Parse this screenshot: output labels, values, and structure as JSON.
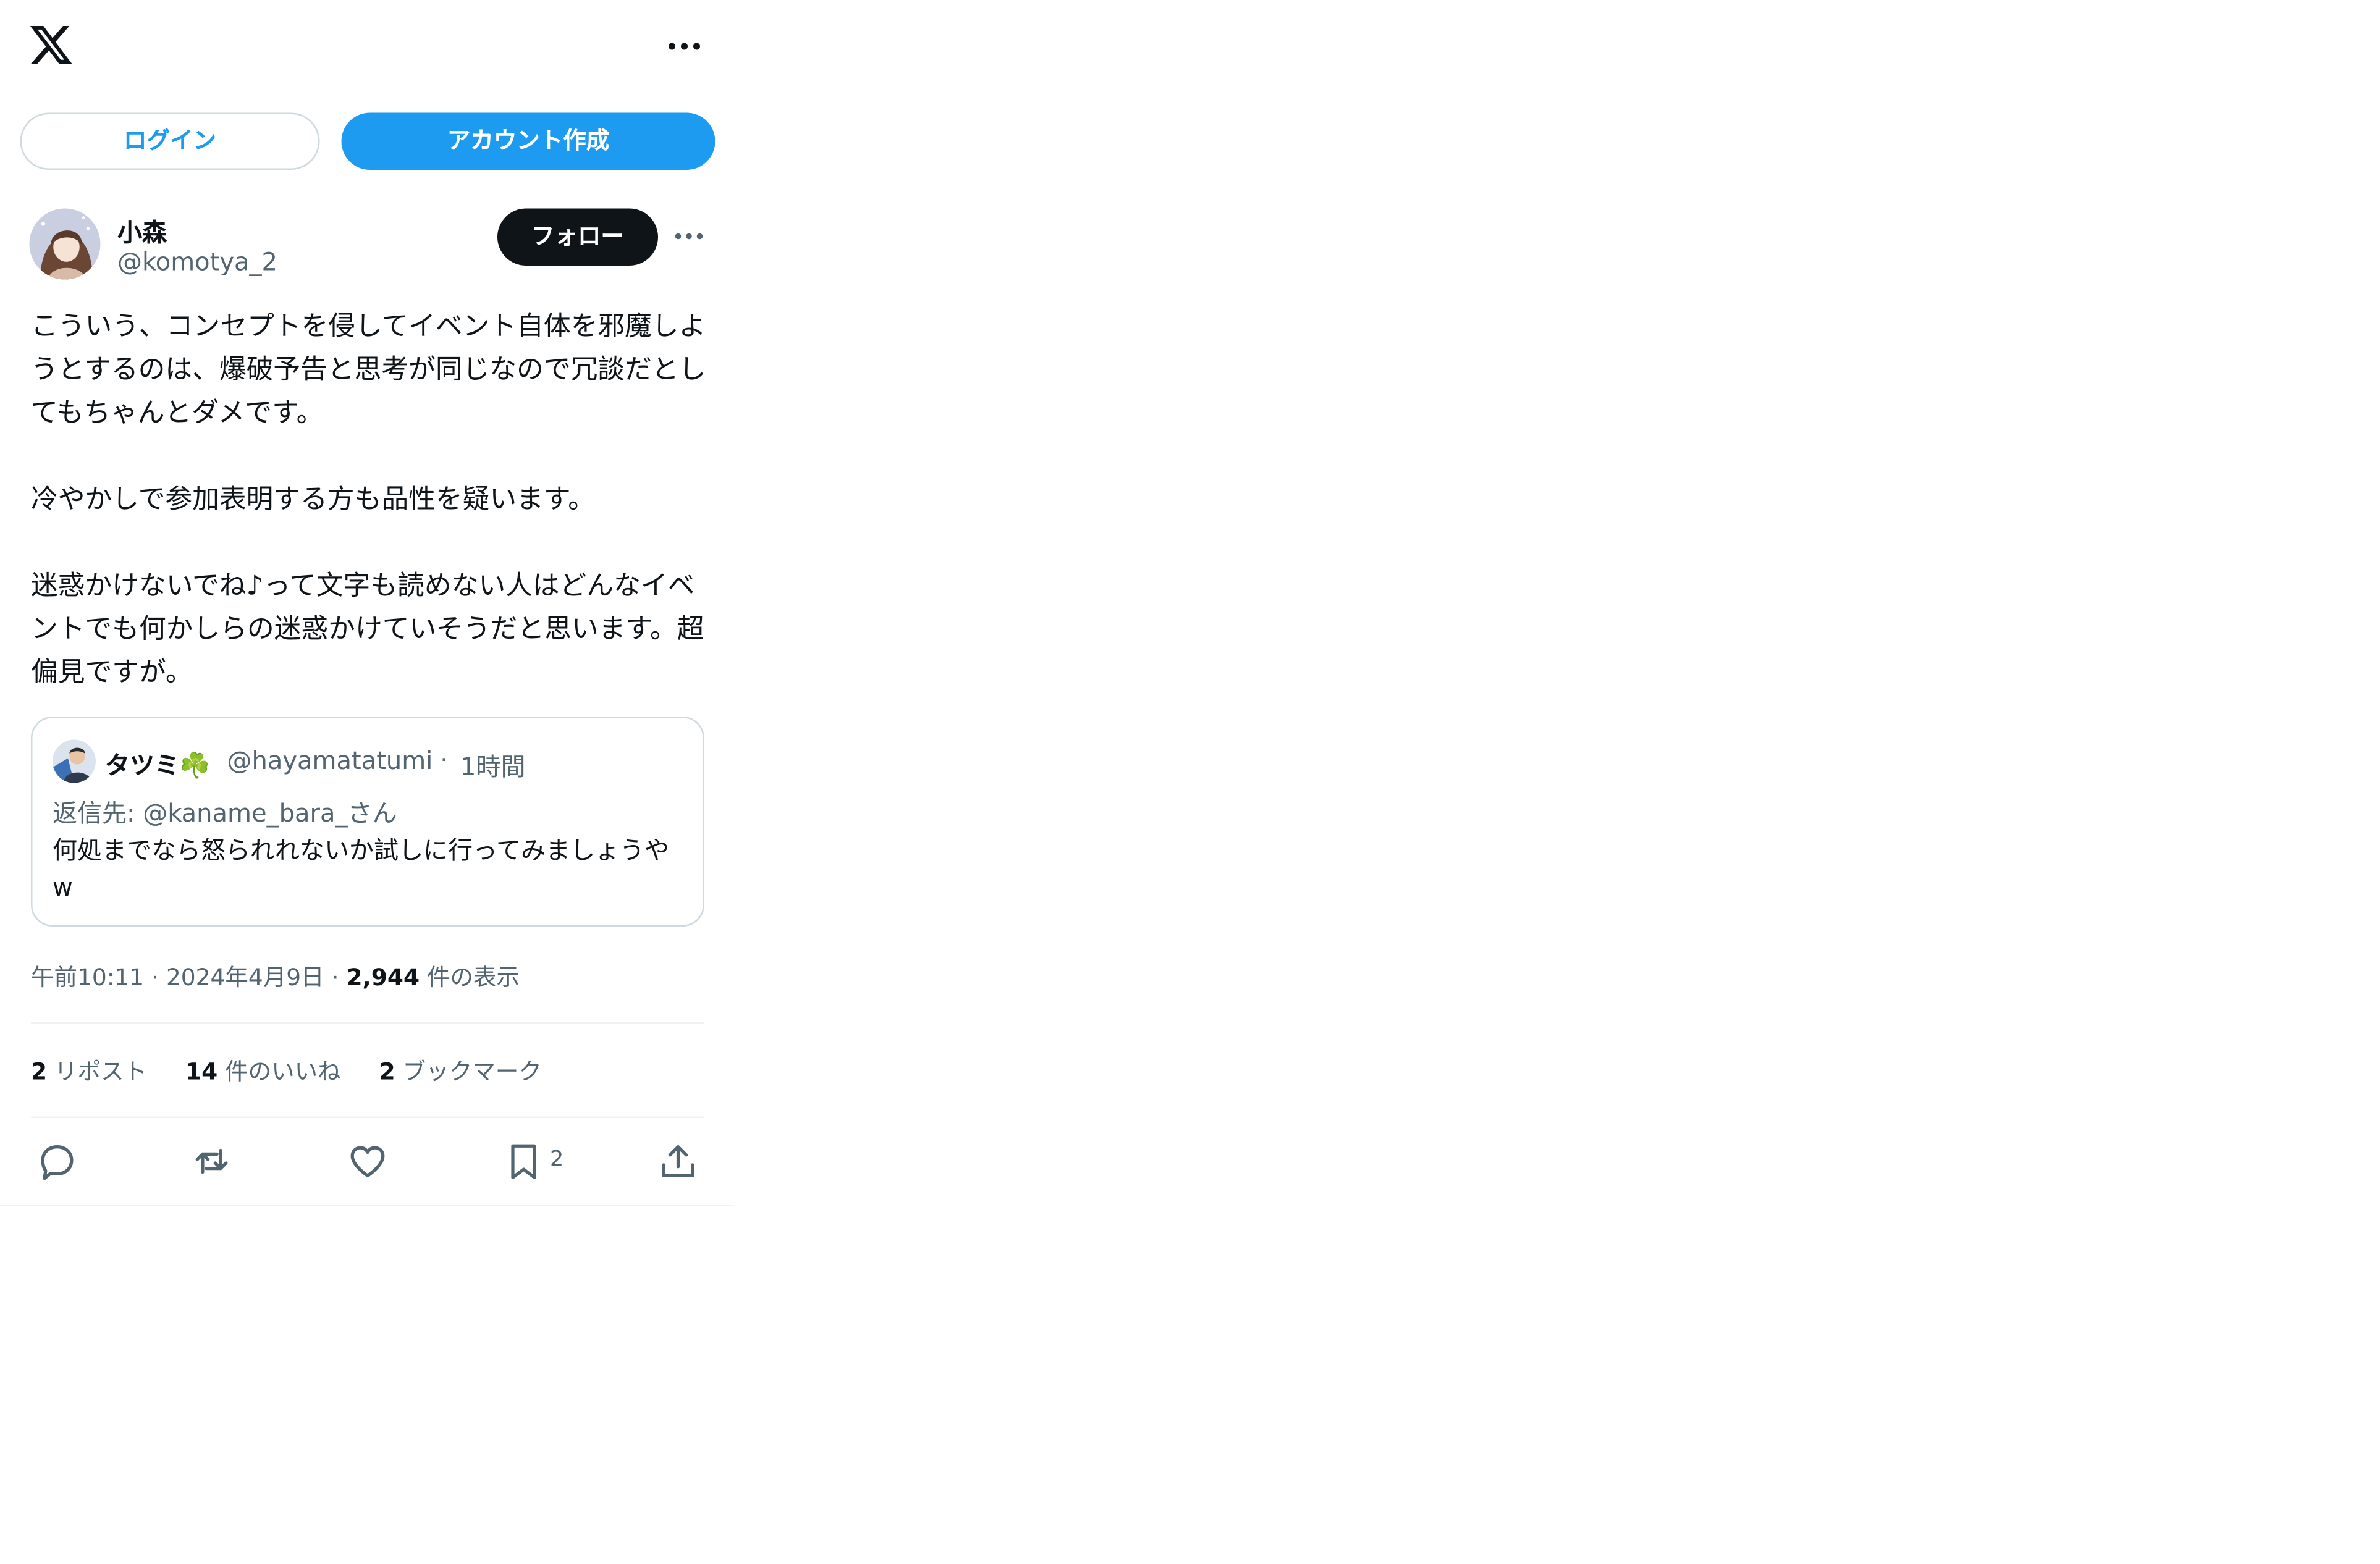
{
  "topbar": {
    "more_label": "···"
  },
  "auth": {
    "login_label": "ログイン",
    "create_account_label": "アカウント作成"
  },
  "tweet": {
    "author_name": "小森",
    "author_handle": "@komotya_2",
    "follow_label": "フォロー",
    "text": "こういう、コンセプトを侵してイベント自体を邪魔しようとするのは、爆破予告と思考が同じなので冗談だとしてもちゃんとダメです。\n\n冷やかしで参加表明する方も品性を疑います。\n\n迷惑かけないでね♪って文字も読めない人はどんなイベントでも何かしらの迷惑かけていそうだと思います。超偏見ですが。",
    "quote": {
      "author_name": "タツミ☘️",
      "author_handle": "@hayamatatumi",
      "dot": "·",
      "time": "1時間",
      "reply_to": "返信先: @kaname_bara_さん",
      "text": "何処までなら怒られれないか試しに行ってみましょうやw"
    },
    "time": "午前10:11",
    "dot": "·",
    "date": "2024年4月9日",
    "views_count": "2,944",
    "views_label": "件の表示",
    "reposts_count": "2",
    "reposts_label": "リポスト",
    "likes_count": "14",
    "likes_label": "件のいいね",
    "bookmarks_count": "2",
    "bookmarks_label": "ブックマーク"
  },
  "actions": {
    "icons": [
      "reply-icon",
      "repost-icon",
      "like-icon",
      "bookmark-icon",
      "share-icon"
    ],
    "bookmark_count": "2"
  },
  "colors": {
    "accent": "#1d9bf0",
    "text": "#0f1419",
    "muted": "#536471",
    "border": "#cfd9de",
    "divider": "#eff3f4"
  }
}
